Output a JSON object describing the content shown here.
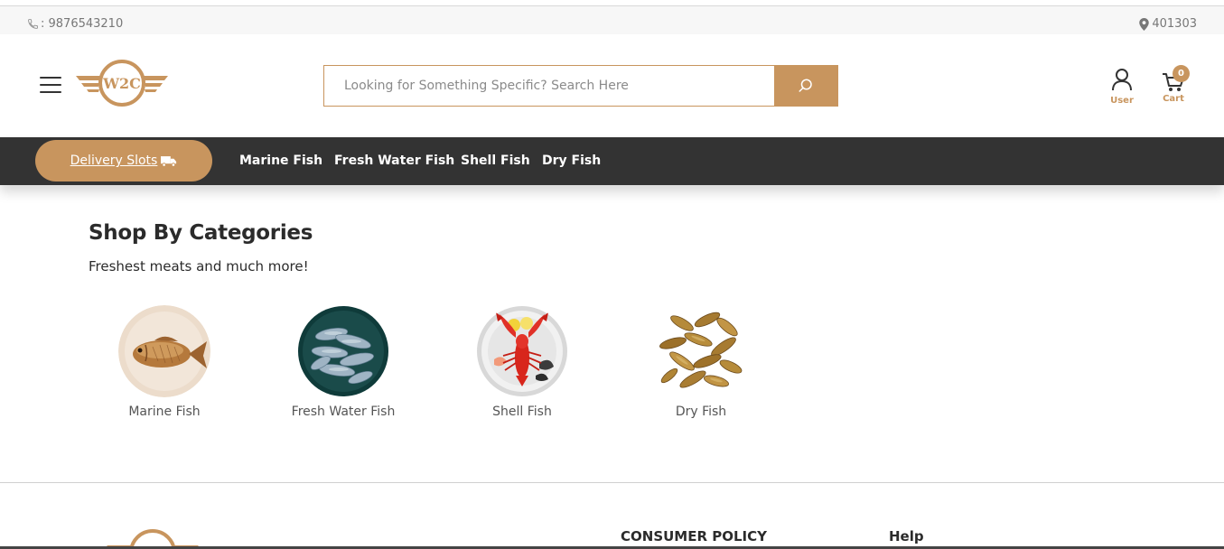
{
  "topbar": {
    "phone": ": 9876543210",
    "pincode": "401303"
  },
  "header": {
    "logo_text": "W2C",
    "search": {
      "placeholder": "Looking for Something Specific? Search Here"
    },
    "user_label": "User",
    "cart_label": "Cart",
    "cart_count": "0"
  },
  "nav": {
    "delivery_label": "Delivery Slots",
    "links": [
      "Marine Fish",
      "Fresh Water Fish",
      "Shell Fish",
      "Dry Fish"
    ]
  },
  "main": {
    "title": "Shop By Categories",
    "subtitle": "Freshest meats and much more!",
    "categories": [
      {
        "name": "Marine Fish"
      },
      {
        "name": "Fresh Water Fish"
      },
      {
        "name": "Shell Fish"
      },
      {
        "name": "Dry Fish"
      }
    ]
  },
  "footer": {
    "consumer_policy": "CONSUMER POLICY",
    "help": "Help"
  },
  "colors": {
    "accent": "#c8955e",
    "navbar": "#333333"
  },
  "icons": [
    "phone-icon",
    "location-pin-icon",
    "hamburger-icon",
    "search-icon",
    "user-icon",
    "cart-icon",
    "truck-icon"
  ]
}
